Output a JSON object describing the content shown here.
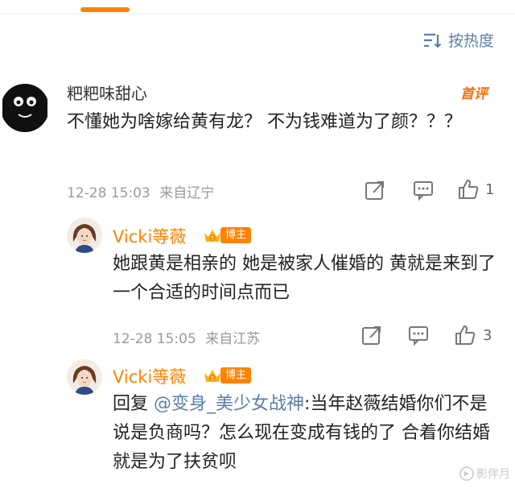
{
  "header": {
    "sort_label": "按热度"
  },
  "comments": [
    {
      "user": "粑粑味甜心",
      "badge": "首评",
      "text": "不懂她为啥嫁给黄有龙？ 不为钱难道为了颜？？？",
      "timestamp": "12-28 15:03",
      "location": "来自辽宁",
      "likes": "1"
    },
    {
      "user": "Vicki等薇",
      "user_badge": "博主",
      "text": "她跟黄是相亲的 她是被家人催婚的 黄就是来到了一个合适的时间点而已",
      "timestamp": "12-28 15:05",
      "location": "来自江苏",
      "likes": "3"
    },
    {
      "user": "Vicki等薇",
      "user_badge": "博主",
      "reply_prefix": "回复",
      "mention": "@变身_美少女战神",
      "text": ":当年赵薇结婚你们不是说是负商吗？怎么现在变成有钱的了 合着你结婚就是为了扶贫呗"
    }
  ],
  "watermark": "影伴月",
  "colors": {
    "accent": "#ff8200",
    "link": "#5b7fa8",
    "meta": "#9a9a9a"
  },
  "icons": [
    "sort-icon",
    "repost-icon",
    "comment-icon",
    "like-icon",
    "crown-icon"
  ]
}
